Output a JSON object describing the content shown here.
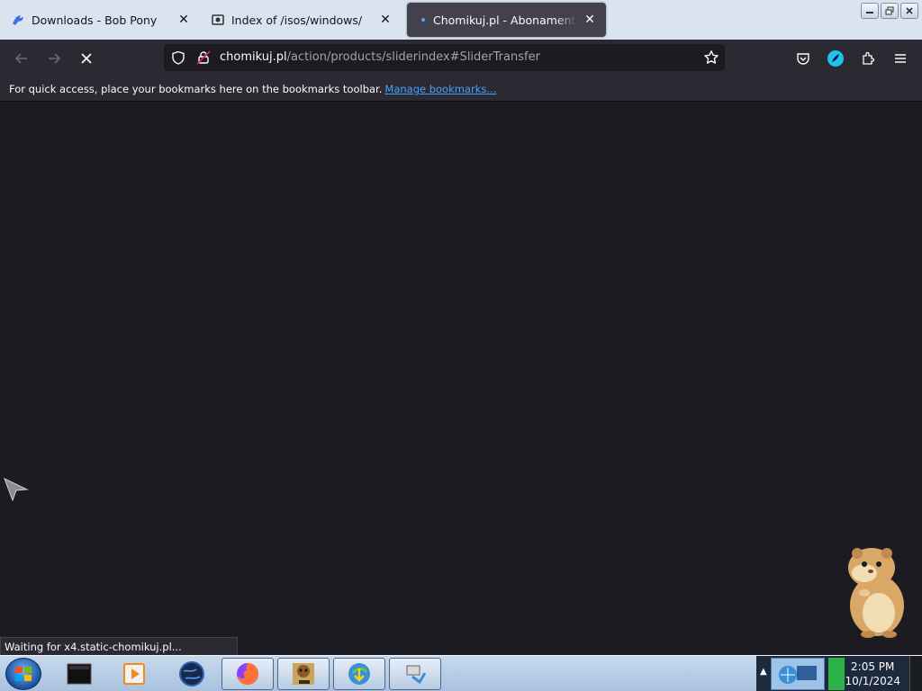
{
  "tabs": [
    {
      "title": "Downloads - Bob Pony",
      "icon": "bob-pony-favicon",
      "active": false
    },
    {
      "title": "Index of /isos/windows/",
      "icon": "folder-favicon",
      "active": false
    },
    {
      "title": "Chomikuj.pl - Abonamenty i Do",
      "icon": "loading-indicator",
      "active": true
    }
  ],
  "navbar": {
    "url_host": "chomikuj.pl",
    "url_path": "/action/products/sliderindex#SliderTransfer"
  },
  "bookmarks_bar": {
    "message": "For quick access, place your bookmarks here on the bookmarks toolbar.",
    "manage_link": "Manage bookmarks..."
  },
  "status_text": "Waiting for x4.static-chomikuj.pl...",
  "taskbar": {
    "items": [
      "terminal-icon",
      "media-player-icon",
      "globe-icon",
      "firefox-icon",
      "box-icon",
      "download-manager-icon",
      "network-icon"
    ],
    "clock_time": "2:05 PM",
    "clock_date": "10/1/2024"
  },
  "colors": {
    "page_bg": "#1c1b22",
    "toolbar_bg": "#2b2a33",
    "link": "#45a1ff",
    "tabstrip_bg": "#d9e4f0"
  }
}
